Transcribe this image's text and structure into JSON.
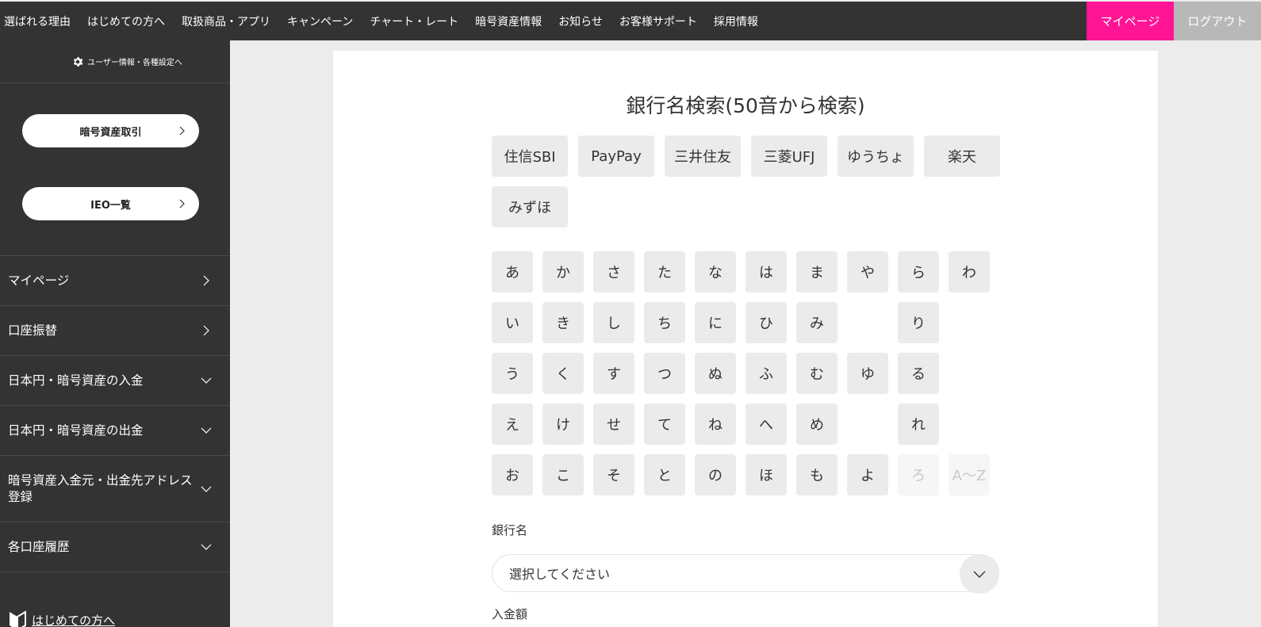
{
  "topnav": {
    "links": [
      "選ばれる理由",
      "はじめての方へ",
      "取扱商品・アプリ",
      "キャンペーン",
      "チャート・レート",
      "暗号資産情報",
      "お知らせ",
      "お客様サポート",
      "採用情報"
    ],
    "mypage_label": "マイページ",
    "logout_label": "ログアウト"
  },
  "sidebar": {
    "settings_label": "ユーザー情報・各種設定へ",
    "pills": [
      "暗号資産取引",
      "IEO一覧"
    ],
    "menu": [
      {
        "label": "マイページ",
        "arrow": "chevron-right-icon"
      },
      {
        "label": "口座振替",
        "arrow": "chevron-right-icon"
      },
      {
        "label": "日本円・暗号資産の入金",
        "arrow": "chevron-down-icon"
      },
      {
        "label": "日本円・暗号資産の出金",
        "arrow": "chevron-down-icon"
      },
      {
        "label": "暗号資産入金元・出金先アドレス登録",
        "arrow": "chevron-down-icon"
      },
      {
        "label": "各口座履歴",
        "arrow": "chevron-down-icon"
      }
    ],
    "beginner_label": "はじめての方へ"
  },
  "main": {
    "title": "銀行名検索(50音から検索)",
    "quick_banks": [
      "住信SBI",
      "PayPay",
      "三井住友",
      "三菱UFJ",
      "ゆうちょ",
      "楽天",
      "みずほ"
    ],
    "kana_rows": [
      [
        "あ",
        "か",
        "さ",
        "た",
        "な",
        "は",
        "ま",
        "や",
        "ら",
        "わ"
      ],
      [
        "い",
        "き",
        "し",
        "ち",
        "に",
        "ひ",
        "み",
        "",
        "り",
        ""
      ],
      [
        "う",
        "く",
        "す",
        "つ",
        "ぬ",
        "ふ",
        "む",
        "ゆ",
        "る",
        ""
      ],
      [
        "え",
        "け",
        "せ",
        "て",
        "ね",
        "へ",
        "め",
        "",
        "れ",
        ""
      ],
      [
        "お",
        "こ",
        "そ",
        "と",
        "の",
        "ほ",
        "も",
        "よ",
        "ろ",
        "A〜Z"
      ]
    ],
    "disabled_kana": [
      "ろ",
      "A〜Z"
    ],
    "bank_name_label": "銀行名",
    "bank_select_value": "選択してください",
    "amount_label": "入金額"
  },
  "colors": {
    "nav_bg": "#333333",
    "mypage_accent": "#ff1493",
    "logout_bg": "#b8b8b8",
    "chip_bg": "#ebebeb"
  }
}
